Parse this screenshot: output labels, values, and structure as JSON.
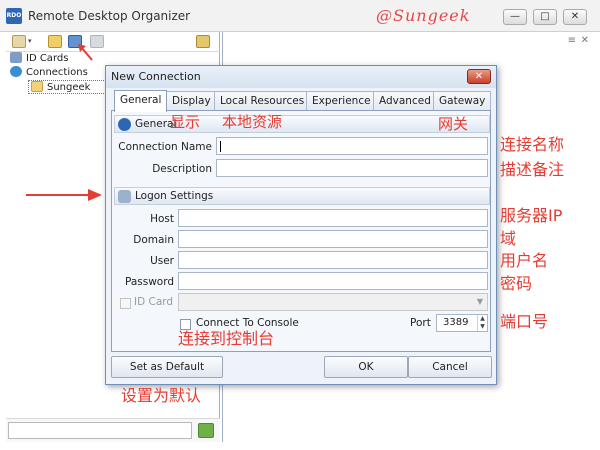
{
  "app": {
    "logo_text": "RDO",
    "title": "Remote Desktop Organizer",
    "watermark": "@Sungeek",
    "controls": {
      "minimize": "—",
      "maximize": "□",
      "close": "✕"
    }
  },
  "tree": {
    "items": [
      {
        "label": "ID Cards",
        "icon": "id-cards-icon"
      },
      {
        "label": "Connections",
        "icon": "globe-icon"
      },
      {
        "label": "Sungeek",
        "icon": "folder-icon"
      }
    ]
  },
  "right_panel": {
    "pin": "≡",
    "close": "✕"
  },
  "dialog": {
    "title": "New Connection",
    "close": "✕",
    "tabs": [
      "General",
      "Display",
      "Local Resources",
      "Experience",
      "Advanced",
      "Gateway"
    ],
    "active_tab": "General",
    "general_group": {
      "title": "General",
      "connection_name_label": "Connection Name",
      "description_label": "Description"
    },
    "logon_group": {
      "title": "Logon Settings",
      "host_label": "Host",
      "domain_label": "Domain",
      "user_label": "User",
      "password_label": "Password",
      "id_card_label": "ID Card",
      "connect_console_label": "Connect To Console",
      "port_label": "Port",
      "port_value": "3389"
    },
    "buttons": {
      "set_default": "Set as Default",
      "ok": "OK",
      "cancel": "Cancel"
    }
  },
  "annotations": {
    "display": "显示",
    "local_resources": "本地资源",
    "gateway": "网关",
    "connection_name": "连接名称",
    "description": "描述备注",
    "server_ip": "服务器IP",
    "domain": "域",
    "username": "用户名",
    "password": "密码",
    "port": "端口号",
    "connect_console": "连接到控制台",
    "set_default": "设置为默认"
  },
  "colors": {
    "annotation": "#e53c33",
    "accent": "#2f66b3"
  }
}
